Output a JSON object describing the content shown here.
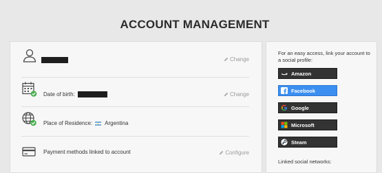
{
  "page": {
    "title": "ACCOUNT MANAGEMENT"
  },
  "account": {
    "rows": [
      {
        "id": "username",
        "label": "",
        "value": "",
        "action": "Change"
      },
      {
        "id": "dob",
        "label": "Date of birth:",
        "value": "",
        "action": "Change"
      },
      {
        "id": "residence",
        "label": "Place of Residence:",
        "value": "Argentina",
        "action": ""
      },
      {
        "id": "payment",
        "label": "Payment methods linked to account",
        "value": "",
        "action": "Configure"
      }
    ]
  },
  "social": {
    "intro": "For an easy access, link your account to a social profile:",
    "buttons": [
      {
        "label": "Amazon",
        "icon": "amazon-icon",
        "active": false
      },
      {
        "label": "Facebook",
        "icon": "facebook-icon",
        "active": true
      },
      {
        "label": "Google",
        "icon": "google-icon",
        "active": false
      },
      {
        "label": "Microsoft",
        "icon": "microsoft-icon",
        "active": false
      },
      {
        "label": "Steam",
        "icon": "steam-icon",
        "active": false
      }
    ],
    "linked_label": "Linked social networks:"
  },
  "colors": {
    "accent": "#3b8ff0",
    "dark_button": "#333333",
    "check": "#4caf50"
  }
}
